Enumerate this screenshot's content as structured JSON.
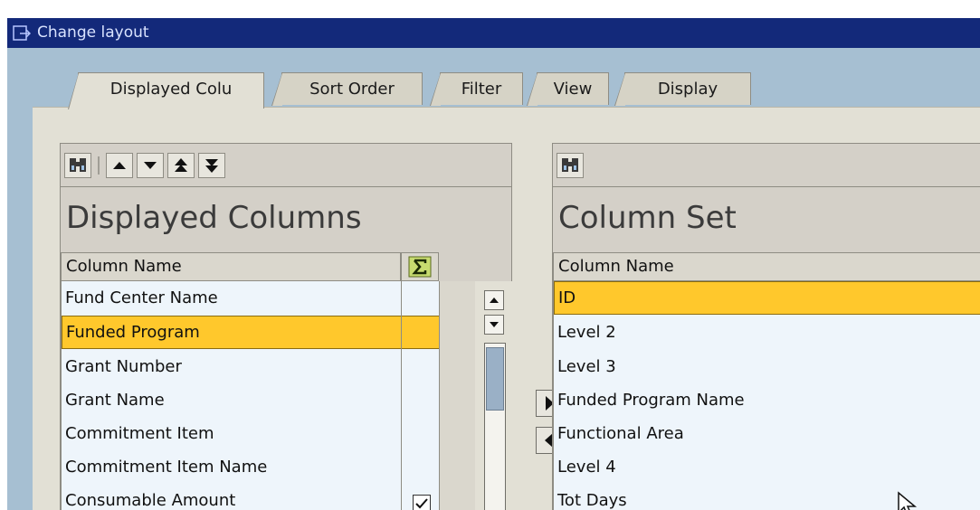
{
  "window": {
    "title": "Change layout"
  },
  "tabs": [
    "Displayed Colu",
    "Sort Order",
    "Filter",
    "View",
    "Display"
  ],
  "left_panel": {
    "title": "Displayed Columns",
    "column_header": "Column Name",
    "sum_icon": "sigma-icon",
    "rows": [
      "Fund Center Name",
      "Funded Program",
      "Grant Number",
      "Grant Name",
      "Commitment Item",
      "Commitment Item Name",
      "Consumable Amount"
    ],
    "selected_row": "Funded Program"
  },
  "right_panel": {
    "title": "Column Set",
    "column_header": "Column Name",
    "rows": [
      "ID",
      "Level 2",
      "Level 3",
      "Funded Program Name",
      "Functional Area",
      "Level 4",
      "Tot Days"
    ],
    "selected_row": "ID"
  },
  "colors": {
    "title_bar": "#13297a",
    "selection": "#ffc82c",
    "list_bg": "#eef5fb",
    "window_bg": "#a6bfd2"
  }
}
